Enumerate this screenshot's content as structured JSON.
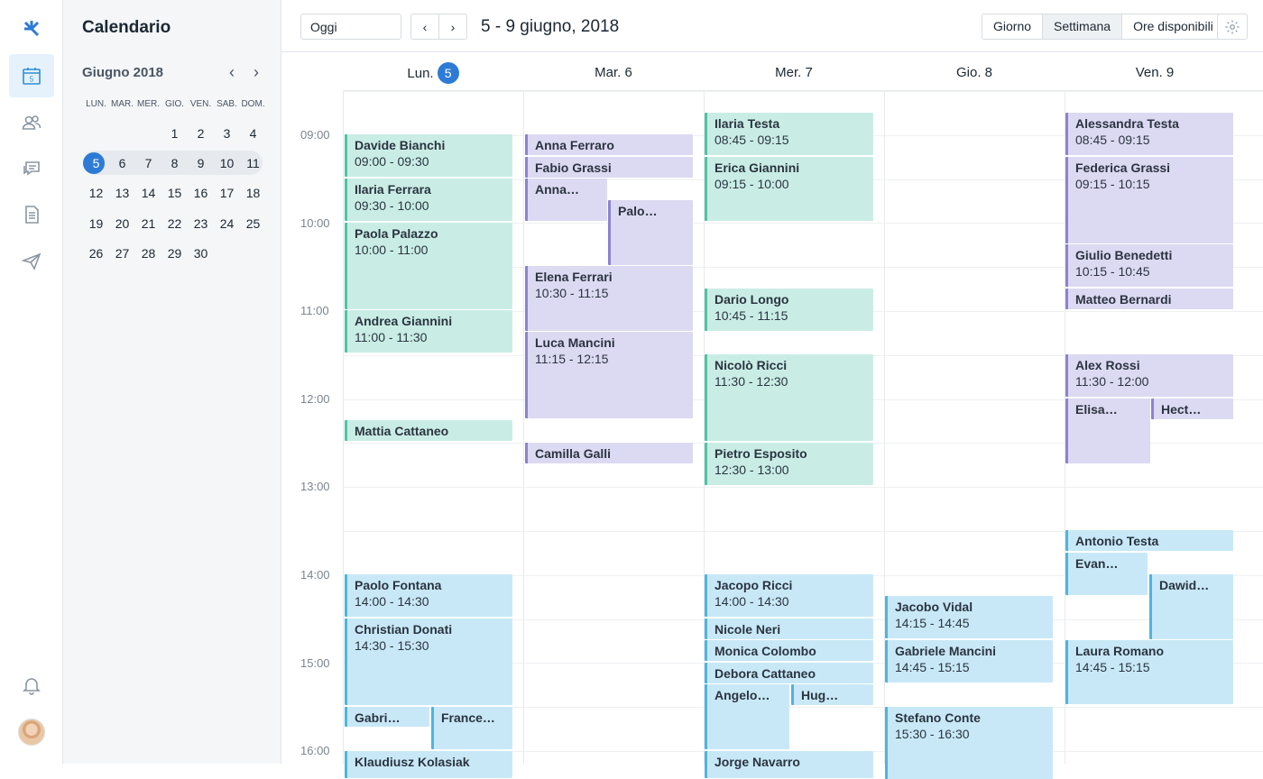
{
  "app": {
    "title": "Calendario"
  },
  "rail": {
    "items": [
      {
        "name": "logo-icon"
      },
      {
        "name": "calendar-icon",
        "badge": "5"
      },
      {
        "name": "patients-icon"
      },
      {
        "name": "messages-icon"
      },
      {
        "name": "documents-icon"
      },
      {
        "name": "send-icon"
      },
      {
        "name": "bell-icon"
      }
    ]
  },
  "mini": {
    "month": "Giugno 2018",
    "weekdays": [
      "LUN.",
      "MAR.",
      "MER.",
      "GIO.",
      "VEN.",
      "SAB.",
      "DOM."
    ],
    "weeks": [
      [
        "",
        "",
        "",
        "1",
        "2",
        "3",
        "4"
      ],
      [
        "5",
        "6",
        "7",
        "8",
        "9",
        "10",
        "11"
      ],
      [
        "12",
        "13",
        "14",
        "15",
        "16",
        "17",
        "18"
      ],
      [
        "19",
        "20",
        "21",
        "22",
        "23",
        "24",
        "25"
      ],
      [
        "26",
        "27",
        "28",
        "29",
        "30",
        "",
        ""
      ]
    ],
    "today": "5"
  },
  "toolbar": {
    "today": "Oggi",
    "range": "5 - 9 giugno, 2018",
    "views": [
      "Giorno",
      "Settimana",
      "Ore disponibili"
    ],
    "active_view": "Settimana"
  },
  "days": [
    {
      "label": "Lun.",
      "num": "5"
    },
    {
      "label": "Mar. 6"
    },
    {
      "label": "Mer. 7"
    },
    {
      "label": "Gio. 8"
    },
    {
      "label": "Ven. 9"
    }
  ],
  "times": [
    "09:00",
    "10:00",
    "11:00",
    "12:00",
    "13:00",
    "14:00",
    "15:00",
    "16:00"
  ],
  "events": [
    {
      "name": "Davide Bianchi",
      "time": "09:00 - 09:30",
      "color": "g"
    },
    {
      "name": "Ilaria Ferrara",
      "time": "09:30 - 10:00",
      "color": "g"
    },
    {
      "name": "Paola Palazzo",
      "time": "10:00 - 11:00",
      "color": "g"
    },
    {
      "name": "Andrea Giannini",
      "time": "11:00 - 11:30",
      "color": "g"
    },
    {
      "name": "Mattia Cattaneo",
      "time": "",
      "color": "g"
    },
    {
      "name": "Anna Ferraro",
      "time": "",
      "color": "p"
    },
    {
      "name": "Fabio Grassi",
      "time": "",
      "color": "p"
    },
    {
      "name": "Anna…",
      "time": "",
      "color": "p"
    },
    {
      "name": "Palo…",
      "time": "",
      "color": "p"
    },
    {
      "name": "Elena Ferrari",
      "time": "10:30 - 11:15",
      "color": "p"
    },
    {
      "name": "Luca Mancini",
      "time": "11:15 - 12:15",
      "color": "p"
    },
    {
      "name": "Camilla Galli",
      "time": "",
      "color": "p"
    },
    {
      "name": "Ilaria Testa",
      "time": "08:45 - 09:15",
      "color": "g"
    },
    {
      "name": "Erica Giannini",
      "time": "09:15 - 10:00",
      "color": "g"
    },
    {
      "name": "Dario Longo",
      "time": "10:45 - 11:15",
      "color": "g"
    },
    {
      "name": "Nicolò Ricci",
      "time": "11:30 - 12:30",
      "color": "g"
    },
    {
      "name": "Pietro Esposito",
      "time": "12:30 - 13:00",
      "color": "g"
    },
    {
      "name": "Alessandra Testa",
      "time": "08:45 - 09:15",
      "color": "p"
    },
    {
      "name": "Federica Grassi",
      "time": "09:15 - 10:15",
      "color": "p"
    },
    {
      "name": "Giulio Benedetti",
      "time": "10:15 - 10:45",
      "color": "p"
    },
    {
      "name": "Matteo Bernardi",
      "time": "",
      "color": "p"
    },
    {
      "name": "Alex Rossi",
      "time": "11:30 - 12:00",
      "color": "p"
    },
    {
      "name": "Elisa…",
      "time": "",
      "color": "p"
    },
    {
      "name": "Hect…",
      "time": "",
      "color": "p"
    },
    {
      "name": "Paolo Fontana",
      "time": "14:00 - 14:30",
      "color": "b"
    },
    {
      "name": "Christian Donati",
      "time": "14:30 - 15:30",
      "color": "b"
    },
    {
      "name": "Gabri…",
      "time": "",
      "color": "b"
    },
    {
      "name": "France…",
      "time": "",
      "color": "b"
    },
    {
      "name": "Klaudiusz Kolasiak",
      "time": "",
      "color": "b"
    },
    {
      "name": "Jacopo Ricci",
      "time": "14:00 - 14:30",
      "color": "b"
    },
    {
      "name": "Nicole Neri",
      "time": "",
      "color": "b"
    },
    {
      "name": "Monica Colombo",
      "time": "",
      "color": "b"
    },
    {
      "name": "Debora Cattaneo",
      "time": "",
      "color": "b"
    },
    {
      "name": "Angelo…",
      "time": "",
      "color": "b"
    },
    {
      "name": "Hug…",
      "time": "",
      "color": "b"
    },
    {
      "name": "Jorge Navarro",
      "time": "",
      "color": "b"
    },
    {
      "name": "Jacobo Vidal",
      "time": "14:15 - 14:45",
      "color": "b"
    },
    {
      "name": "Gabriele Mancini",
      "time": "14:45 - 15:15",
      "color": "b"
    },
    {
      "name": "Stefano Conte",
      "time": "15:30 - 16:30",
      "color": "b"
    },
    {
      "name": "Antonio Testa",
      "time": "",
      "color": "b"
    },
    {
      "name": "Evan…",
      "time": "",
      "color": "b"
    },
    {
      "name": "Dawid…",
      "time": "",
      "color": "b"
    },
    {
      "name": "Laura Romano",
      "time": "14:45 - 15:15",
      "color": "b"
    }
  ]
}
